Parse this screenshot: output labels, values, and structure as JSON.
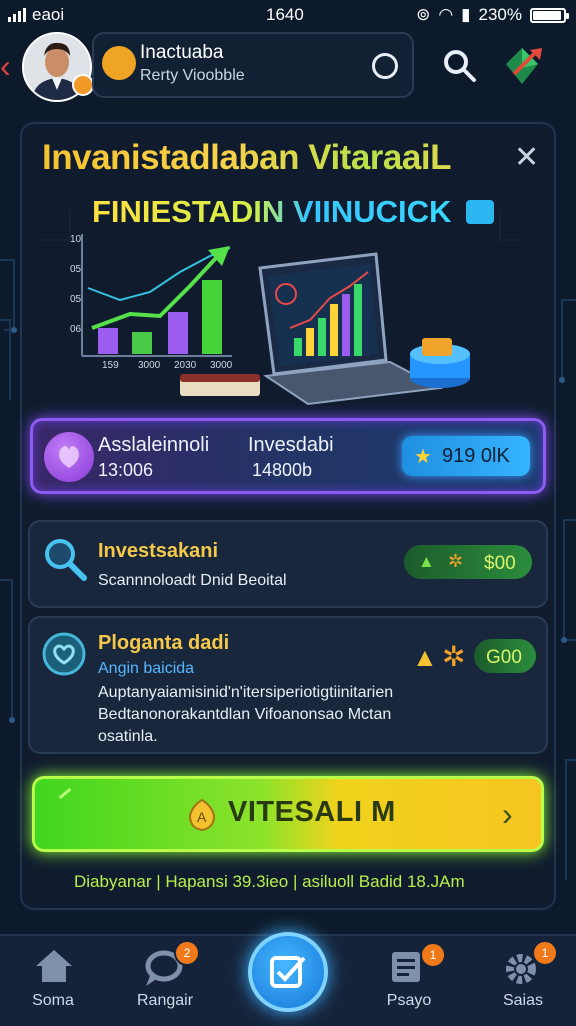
{
  "status_bar": {
    "carrier": "eaoi",
    "time": "1640",
    "battery": "230%"
  },
  "header": {
    "profile_name": "Inactuaba",
    "profile_sub": "Rerty Vioobble"
  },
  "banner": {
    "title_line1": "Invanistadlaban VitaraaiL",
    "title_line2": "FINIESTADIN VIINUCICK"
  },
  "chart_mini": {
    "tick_labels_x": [
      "159",
      "3000",
      "2030",
      "3000"
    ],
    "tick_labels_y": [
      "10",
      "05",
      "05",
      "06"
    ]
  },
  "stats": {
    "a_label": "Asslaleinnoli",
    "a_value": "13:006",
    "b_label": "Invesdabi",
    "b_value": "14800b",
    "coins": "919 0lK"
  },
  "card1": {
    "title": "Investsakani",
    "sub": "Scannnoloadt Dnid Beoital",
    "reward": "$00"
  },
  "card2": {
    "title": "Ploganta dadi",
    "sub_blue": "Angin baicida",
    "desc_line1": "Auptanyaiamisinid'n'itersiperiotigtiinitarien",
    "desc_line2": "Bedtanonorakantdlan Vifoanonsao Mctan",
    "desc_line3": "osatinla.",
    "reward": "G00"
  },
  "cta": {
    "label": "VITESALI M"
  },
  "footer": {
    "info": "Diabyanar | Hapansi 39.3ieo | asiluoll Badid 18.JAm"
  },
  "nav": {
    "items": [
      {
        "label": "Soma"
      },
      {
        "label": "Rangair",
        "badge": "2"
      },
      {
        "label": "Psayo",
        "badge": "1"
      },
      {
        "label": "Saias",
        "badge": "1"
      }
    ]
  }
}
